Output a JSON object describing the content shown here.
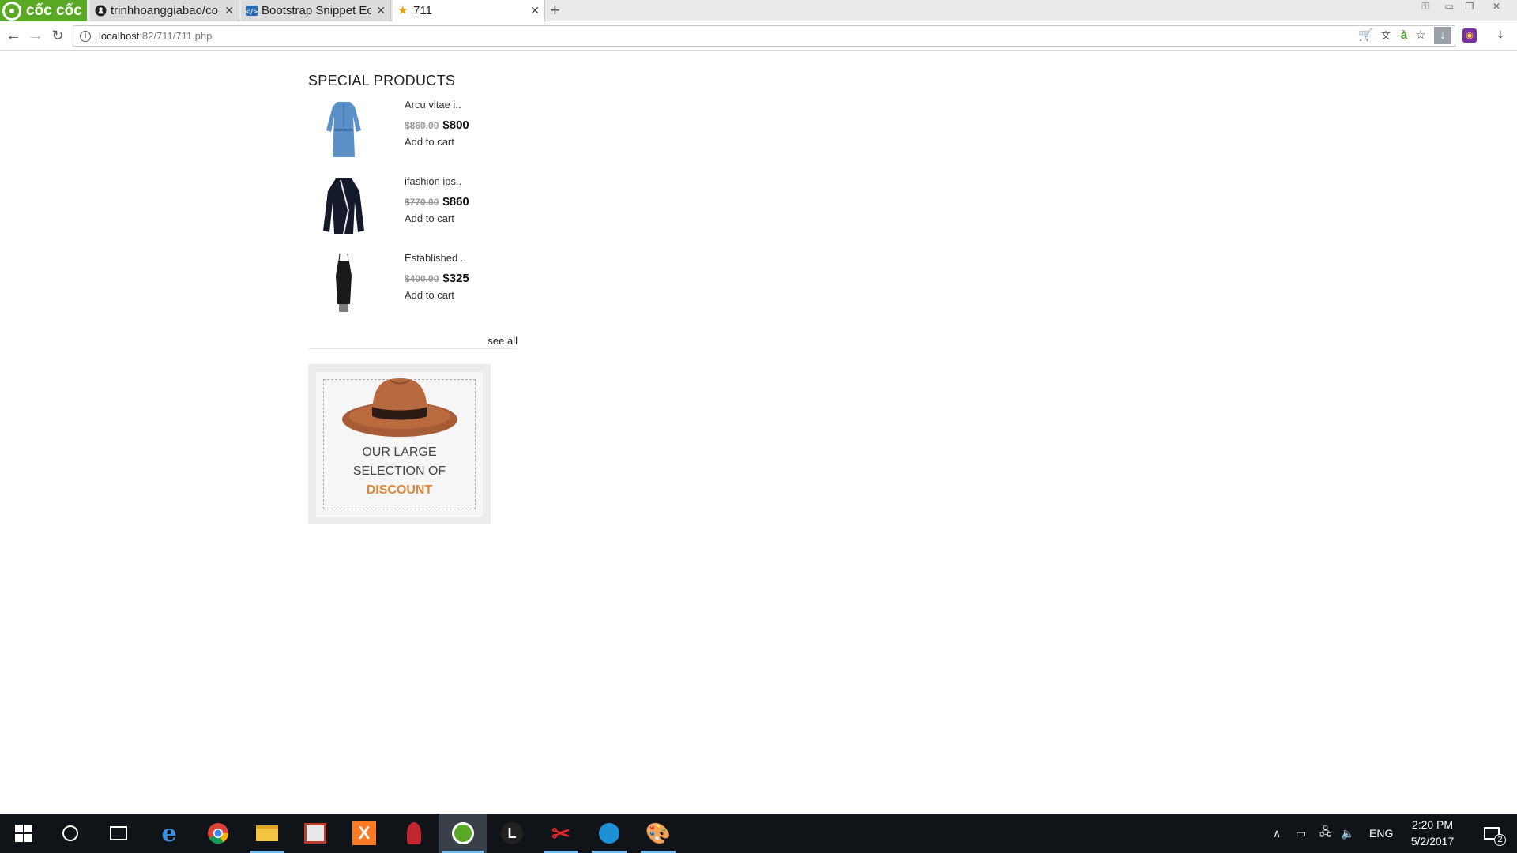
{
  "browser": {
    "brand": "cốc cốc",
    "tabs": [
      {
        "title": "trinhhoanggiabao/co",
        "icon": "github-icon"
      },
      {
        "title": "Bootstrap Snippet Ec",
        "icon": "bootstrap-snippet-icon"
      },
      {
        "title": "711",
        "icon": "star-icon"
      }
    ],
    "url_host": "localhost",
    "url_path": ":82/711/711.php"
  },
  "page": {
    "section_title": "SPECIAL PRODUCTS",
    "products": [
      {
        "name": "Arcu vitae i..",
        "old_price": "$860.00",
        "new_price": "$800",
        "cart": "Add to cart",
        "image": "denim-dress"
      },
      {
        "name": "ifashion ips..",
        "old_price": "$770.00",
        "new_price": "$860",
        "cart": "Add to cart",
        "image": "black-jacket"
      },
      {
        "name": "Established ..",
        "old_price": "$400.00",
        "new_price": "$325",
        "cart": "Add to cart",
        "image": "black-slip-dress"
      }
    ],
    "see_all": "see all",
    "promo": {
      "line1": "OUR LARGE",
      "line2": "SELECTION OF",
      "highlight": "DISCOUNT"
    }
  },
  "taskbar": {
    "language": "ENG",
    "time": "2:20 PM",
    "date": "5/2/2017",
    "notifications": "2"
  },
  "colors": {
    "accent_discount": "#d9873d",
    "coccoc_green": "#5aa924",
    "taskbar_bg": "#101418"
  }
}
